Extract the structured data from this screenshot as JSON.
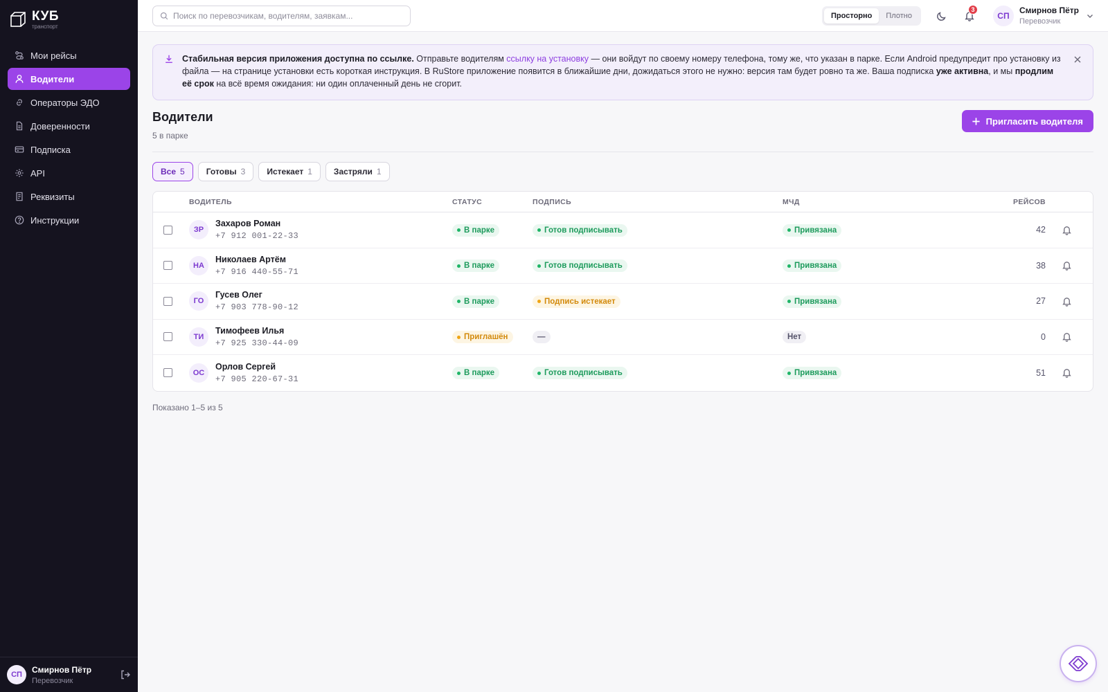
{
  "brand": {
    "name": "КУБ",
    "sub": "транспорт"
  },
  "sidebar": {
    "items": [
      {
        "label": "Мои рейсы",
        "icon": "route-icon",
        "active": false
      },
      {
        "label": "Водители",
        "icon": "user-icon",
        "active": true
      },
      {
        "label": "Операторы ЭДО",
        "icon": "link-icon",
        "active": false
      },
      {
        "label": "Доверенности",
        "icon": "document-icon",
        "active": false
      },
      {
        "label": "Подписка",
        "icon": "card-icon",
        "active": false
      },
      {
        "label": "API",
        "icon": "gear-icon",
        "active": false
      },
      {
        "label": "Реквизиты",
        "icon": "receipt-icon",
        "active": false
      },
      {
        "label": "Инструкции",
        "icon": "help-icon",
        "active": false
      }
    ],
    "user": {
      "initials": "СП",
      "name": "Смирнов Пётр",
      "role": "Перевозчик"
    }
  },
  "topbar": {
    "search_placeholder": "Поиск по перевозчикам, водителям, заявкам...",
    "density": {
      "spacious": "Просторно",
      "compact": "Плотно",
      "selected": "Просторно"
    },
    "notifications_count": "3",
    "user": {
      "initials": "СП",
      "name": "Смирнов Пётр",
      "role": "Перевозчик"
    }
  },
  "banner": {
    "bold_lead": "Стабильная версия приложения доступна по ссылке.",
    "t1": " Отправьте водителям ",
    "link": "ссылку на установку",
    "t2": " — они войдут по своему номеру телефона, тому же, что указан в парке. Если Android предупредит про установку из файла — на странице установки есть короткая инструкция. В RuStore приложение появится в ближайшие дни, дожидаться этого не нужно: версия там будет ровно та же. Ваша подписка ",
    "bold2": "уже активна",
    "t3": ", и мы ",
    "bold3": "продлим её срок",
    "t4": " на всё время ожидания: ни один оплаченный день не сгорит."
  },
  "page": {
    "title": "Водители",
    "subtitle": "5 в парке",
    "invite_label": "Пригласить водителя"
  },
  "filters": [
    {
      "label": "Все",
      "count": "5",
      "active": true
    },
    {
      "label": "Готовы",
      "count": "3",
      "active": false
    },
    {
      "label": "Истекает",
      "count": "1",
      "active": false
    },
    {
      "label": "Застряли",
      "count": "1",
      "active": false
    }
  ],
  "table": {
    "headers": {
      "driver": "ВОДИТЕЛЬ",
      "status": "СТАТУС",
      "sign": "ПОДПИСЬ",
      "mcd": "МЧД",
      "trips": "РЕЙСОВ"
    },
    "rows": [
      {
        "initials": "ЗР",
        "name": "Захаров Роман",
        "phone": "+7 912 001-22-33",
        "status": "В парке",
        "status_tone": "green",
        "sign": "Готов подписывать",
        "sign_tone": "green",
        "mcd": "Привязана",
        "mcd_tone": "green",
        "trips": "42"
      },
      {
        "initials": "НА",
        "name": "Николаев Артём",
        "phone": "+7 916 440-55-71",
        "status": "В парке",
        "status_tone": "green",
        "sign": "Готов подписывать",
        "sign_tone": "green",
        "mcd": "Привязана",
        "mcd_tone": "green",
        "trips": "38"
      },
      {
        "initials": "ГО",
        "name": "Гусев Олег",
        "phone": "+7 903 778-90-12",
        "status": "В парке",
        "status_tone": "green",
        "sign": "Подпись истекает",
        "sign_tone": "amber",
        "mcd": "Привязана",
        "mcd_tone": "green",
        "trips": "27"
      },
      {
        "initials": "ТИ",
        "name": "Тимофеев Илья",
        "phone": "+7 925 330-44-09",
        "status": "Приглашён",
        "status_tone": "amber",
        "sign": "—",
        "sign_tone": "gray",
        "mcd": "Нет",
        "mcd_tone": "gray",
        "trips": "0"
      },
      {
        "initials": "ОС",
        "name": "Орлов Сергей",
        "phone": "+7 905 220-67-31",
        "status": "В парке",
        "status_tone": "green",
        "sign": "Готов подписывать",
        "sign_tone": "green",
        "mcd": "Привязана",
        "mcd_tone": "green",
        "trips": "51"
      }
    ]
  },
  "pager": "Показано 1–5 из 5",
  "colors": {
    "accent": "#9b44e8",
    "sidebar_bg": "#15131f",
    "ok": "#1fb567",
    "warn": "#f0a514"
  }
}
